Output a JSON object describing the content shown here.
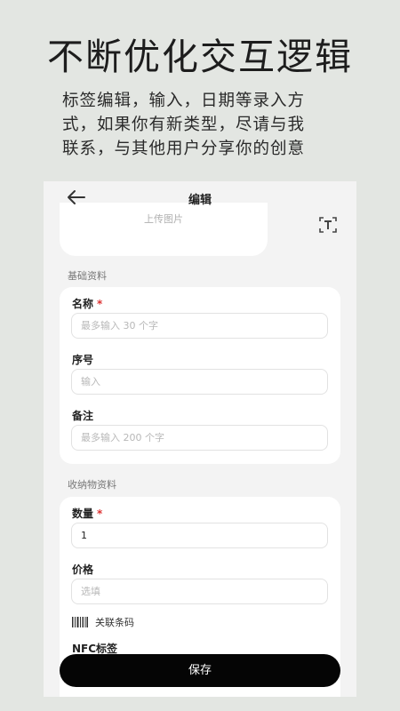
{
  "promo": {
    "headline": "不断优化交互逻辑",
    "description_lines": [
      "标签编辑，输入，日期等录入方",
      "式，如果你有新类型，尽请与我",
      "联系，与其他用户分享你的创意"
    ]
  },
  "topbar": {
    "back_icon": "arrow-left-icon",
    "title": "编辑"
  },
  "upload": {
    "label": "上传图片",
    "text_icon": "text-recognition-icon"
  },
  "basic_info": {
    "section_title": "基础资料",
    "fields": [
      {
        "label": "名称",
        "required_mark": "*",
        "value": "",
        "placeholder": "最多输入 30 个字"
      },
      {
        "label": "序号",
        "value": "",
        "placeholder": "输入"
      },
      {
        "label": "备注",
        "value": "",
        "placeholder": "最多输入 200 个字"
      }
    ]
  },
  "storage_info": {
    "section_title": "收纳物资料",
    "fields": [
      {
        "label": "数量",
        "required_mark": "*",
        "value": "1",
        "placeholder": ""
      },
      {
        "label": "价格",
        "value": "",
        "placeholder": "选填"
      }
    ],
    "barcode": {
      "icon": "barcode-icon",
      "label": "关联条码"
    },
    "nfc_label": "NFC标签"
  },
  "actions": {
    "save_label": "保存"
  },
  "colors": {
    "background": "#e3e6e2",
    "required": "#dd3333",
    "save_button": "#050505"
  }
}
